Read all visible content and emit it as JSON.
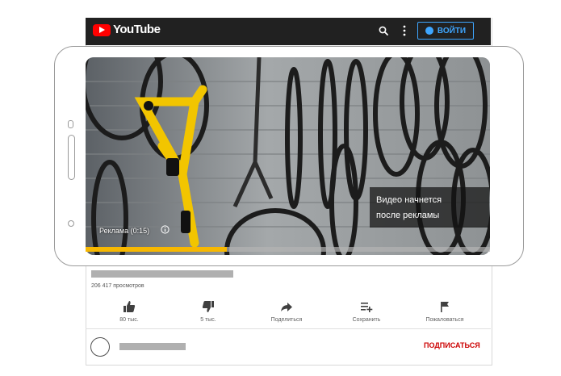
{
  "header": {
    "logo_text": "YouTube",
    "signin_label": "ВОЙТИ",
    "icons": [
      "search-icon",
      "more-vert-icon",
      "account-circle-icon"
    ]
  },
  "player": {
    "ad_overlay_text_line1": "Видео начнется",
    "ad_overlay_text_line2": "после рекламы",
    "ad_label": "Реклама (0:15)",
    "ad_progress": 0.35,
    "progress_color": "#f7b801"
  },
  "video_info": {
    "views": "206 417 просмотров"
  },
  "actions": [
    {
      "icon": "thumb-up-icon",
      "label": "80 тыс."
    },
    {
      "icon": "thumb-down-icon",
      "label": "5 тыс."
    },
    {
      "icon": "share-icon",
      "label": "Поделиться"
    },
    {
      "icon": "playlist-add-icon",
      "label": "Сохранить"
    },
    {
      "icon": "flag-icon",
      "label": "Пожаловаться"
    }
  ],
  "channel": {
    "subscribe_label": "ПОДПИСАТЬСЯ"
  },
  "colors": {
    "brand_red": "#ff0000",
    "signin_blue": "#3ea6ff",
    "topbar": "#212121",
    "subscribe_red": "#cc0000"
  }
}
